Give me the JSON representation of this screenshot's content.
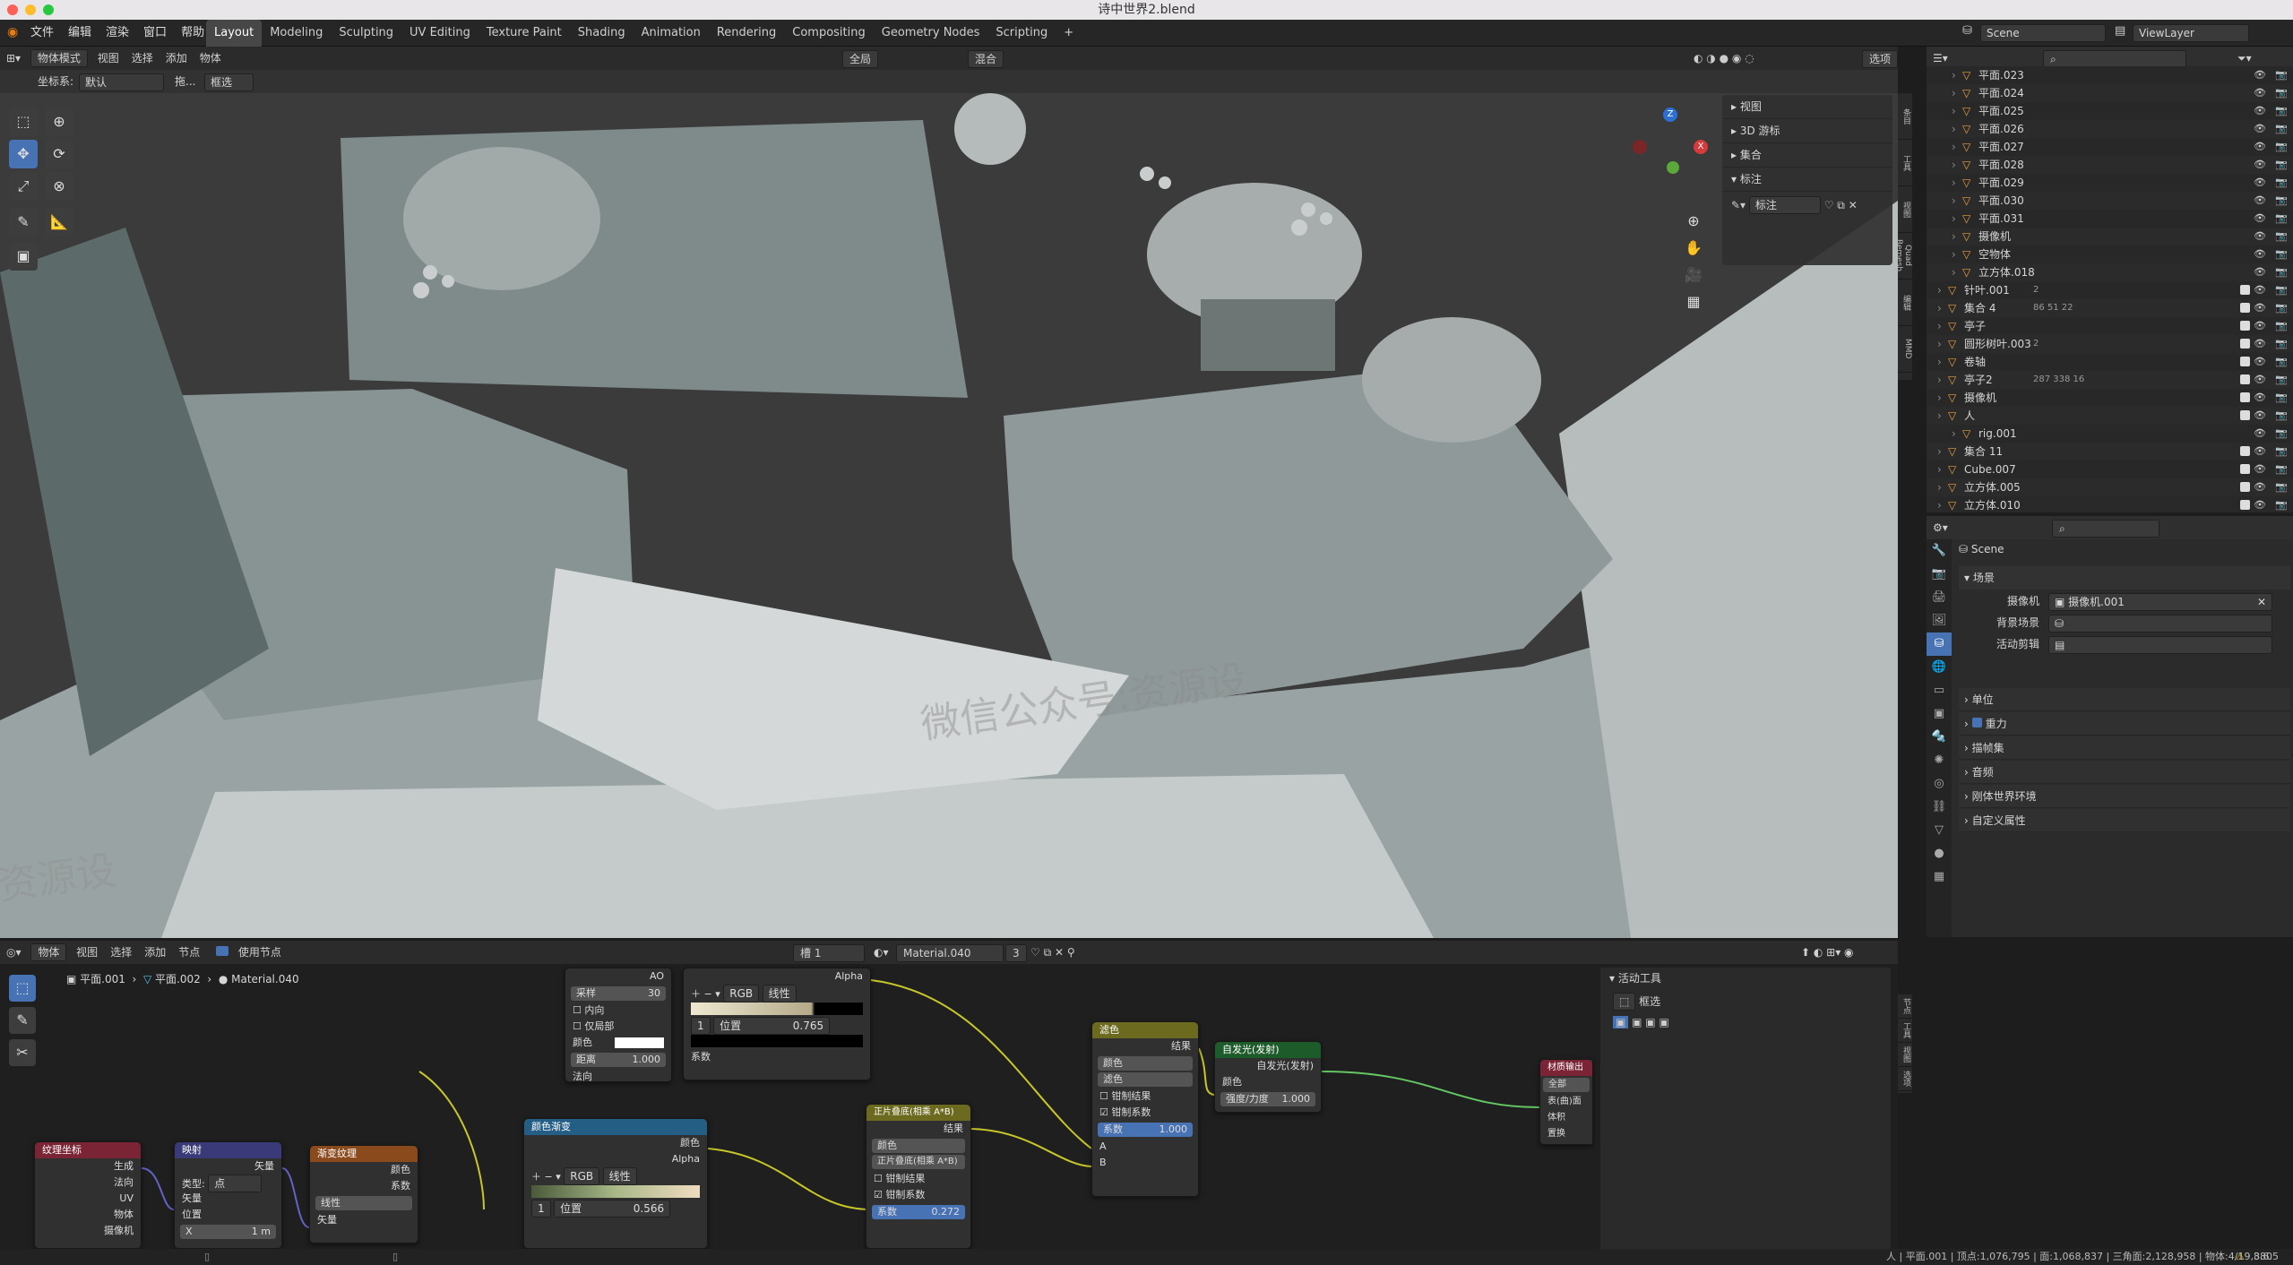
{
  "window": {
    "title": "诗中世界2.blend"
  },
  "menu": [
    "文件",
    "编辑",
    "渲染",
    "窗口",
    "帮助"
  ],
  "workspaces": [
    "Layout",
    "Modeling",
    "Sculpting",
    "UV Editing",
    "Texture Paint",
    "Shading",
    "Animation",
    "Rendering",
    "Compositing",
    "Geometry Nodes",
    "Scripting",
    "+"
  ],
  "active_workspace": "Layout",
  "scene": {
    "name": "Scene",
    "view_layer": "ViewLayer"
  },
  "viewport": {
    "header": {
      "mode": "物体模式",
      "menus": [
        "视图",
        "选择",
        "添加",
        "物体"
      ],
      "transform": "全局",
      "shading": "混合",
      "options": "选项"
    },
    "subheader": {
      "coord_label": "坐标系:",
      "coord_value": "默认",
      "drag_label": "拖...",
      "select_value": "框选"
    },
    "npanel": {
      "sections": [
        "视图",
        "3D 游标",
        "集合",
        "标注"
      ],
      "annotation_value": "标注"
    },
    "side_tabs": [
      "条目",
      "工具",
      "视图",
      "Quad Remesh",
      "编辑",
      "MMD"
    ],
    "watermark": "微信公众号:资源设",
    "watermark2": "资源设"
  },
  "outliner": {
    "rows": [
      {
        "name": "平面.023",
        "indent": 2
      },
      {
        "name": "平面.024",
        "indent": 2
      },
      {
        "name": "平面.025",
        "indent": 2
      },
      {
        "name": "平面.026",
        "indent": 2
      },
      {
        "name": "平面.027",
        "indent": 2
      },
      {
        "name": "平面.028",
        "indent": 2
      },
      {
        "name": "平面.029",
        "indent": 2
      },
      {
        "name": "平面.030",
        "indent": 2
      },
      {
        "name": "平面.031",
        "indent": 2
      },
      {
        "name": "摄像机",
        "indent": 2
      },
      {
        "name": "空物体",
        "indent": 2
      },
      {
        "name": "立方体.018",
        "indent": 2
      },
      {
        "name": "针叶.001",
        "indent": 1,
        "badge": "2"
      },
      {
        "name": "集合 4",
        "indent": 1,
        "badge": "86 51 22"
      },
      {
        "name": "亭子",
        "indent": 1
      },
      {
        "name": "圆形树叶.003",
        "indent": 1,
        "badge": "2"
      },
      {
        "name": "卷轴",
        "indent": 1
      },
      {
        "name": "亭子2",
        "indent": 1,
        "badge": "287 338 16"
      },
      {
        "name": "摄像机",
        "indent": 1
      },
      {
        "name": "人",
        "indent": 1
      },
      {
        "name": "rig.001",
        "indent": 2
      },
      {
        "name": "集合 11",
        "indent": 1
      },
      {
        "name": "Cube.007",
        "indent": 1
      },
      {
        "name": "立方体.005",
        "indent": 1
      },
      {
        "name": "立方体.010",
        "indent": 1
      }
    ]
  },
  "properties": {
    "title": "Scene",
    "section_scene": "场景",
    "camera_label": "摄像机",
    "camera_value": "摄像机.001",
    "bg_label": "背景场景",
    "clip_label": "活动剪辑",
    "sections": [
      "单位",
      "重力",
      "描帧集",
      "音频",
      "刚体世界环境",
      "自定义属性"
    ]
  },
  "node_editor": {
    "header": {
      "type": "物体",
      "menus": [
        "视图",
        "选择",
        "添加",
        "节点"
      ],
      "use_nodes": "使用节点",
      "slot": "槽 1",
      "material": "Material.040",
      "users": "3"
    },
    "breadcrumb": [
      "平面.001",
      "平面.002",
      "Material.040"
    ],
    "active_tool": {
      "title": "活动工具",
      "label": "框选"
    },
    "side_tabs": [
      "节点",
      "工具",
      "视图",
      "选项"
    ],
    "nodes": {
      "ao": {
        "out": "AO",
        "samples_label": "采样",
        "samples": "30",
        "inside": "内向",
        "only_local": "仅局部",
        "color": "颜色",
        "distance_label": "距离",
        "distance": "1.000",
        "normal": "法向"
      },
      "ramp1": {
        "alpha": "Alpha",
        "mode": "RGB",
        "interp": "线性",
        "index": "1",
        "pos_label": "位置",
        "pos": "0.765",
        "factor": "系数"
      },
      "texcoord": {
        "title": "纹理坐标",
        "outs": [
          "生成",
          "法向",
          "UV",
          "物体",
          "摄像机"
        ]
      },
      "mapping": {
        "title": "映射",
        "vector": "矢量",
        "type_label": "类型:",
        "type": "点",
        "in_vector": "矢量",
        "location": "位置",
        "x": "X",
        "x_val": "1 m"
      },
      "gradient": {
        "title": "渐变纹理",
        "color": "颜色",
        "factor": "系数",
        "type": "线性",
        "vector": "矢量"
      },
      "ramp2": {
        "title": "颜色渐变",
        "color": "颜色",
        "alpha": "Alpha",
        "mode": "RGB",
        "interp": "线性",
        "index": "1",
        "pos_label": "位置",
        "pos": "0.566"
      },
      "mix1": {
        "title": "正片叠底(相乘 A*B)",
        "result": "结果",
        "data": "颜色",
        "blend": "正片叠底(相乘 A*B)",
        "clamp": "钳制结果",
        "clamp_factor": "钳制系数",
        "factor_label": "系数",
        "factor": "0.272"
      },
      "mix2": {
        "title": "滤色",
        "result": "结果",
        "data": "颜色",
        "blend": "滤色",
        "clamp": "钳制结果",
        "clamp_factor": "钳制系数",
        "factor_label": "系数",
        "factor": "1.000",
        "a": "A",
        "b": "B"
      },
      "emission": {
        "title": "自发光(发射)",
        "out": "自发光(发射)",
        "color": "颜色",
        "strength_label": "强度/力度",
        "strength": "1.000"
      },
      "output": {
        "title": "材质输出",
        "target": "全部",
        "surface": "表(曲)面",
        "volume": "体积",
        "disp": "置换"
      }
    }
  },
  "status": {
    "text": "人 | 平面.001 | 顶点:1,076,795 | 面:1,068,837 | 三角面:2,128,958 | 物体:4/19,880",
    "version": "3.6.5"
  },
  "colors": {
    "accent": "#4772b3",
    "yellow_link": "#c7c729",
    "green_link": "#63c763",
    "header_yellow": "#6c6a1e",
    "header_green": "#1e5b2a",
    "header_blue": "#245e85",
    "header_red": "#7a2436",
    "header_purple": "#3a3a78",
    "header_orange": "#8a4a1c"
  }
}
